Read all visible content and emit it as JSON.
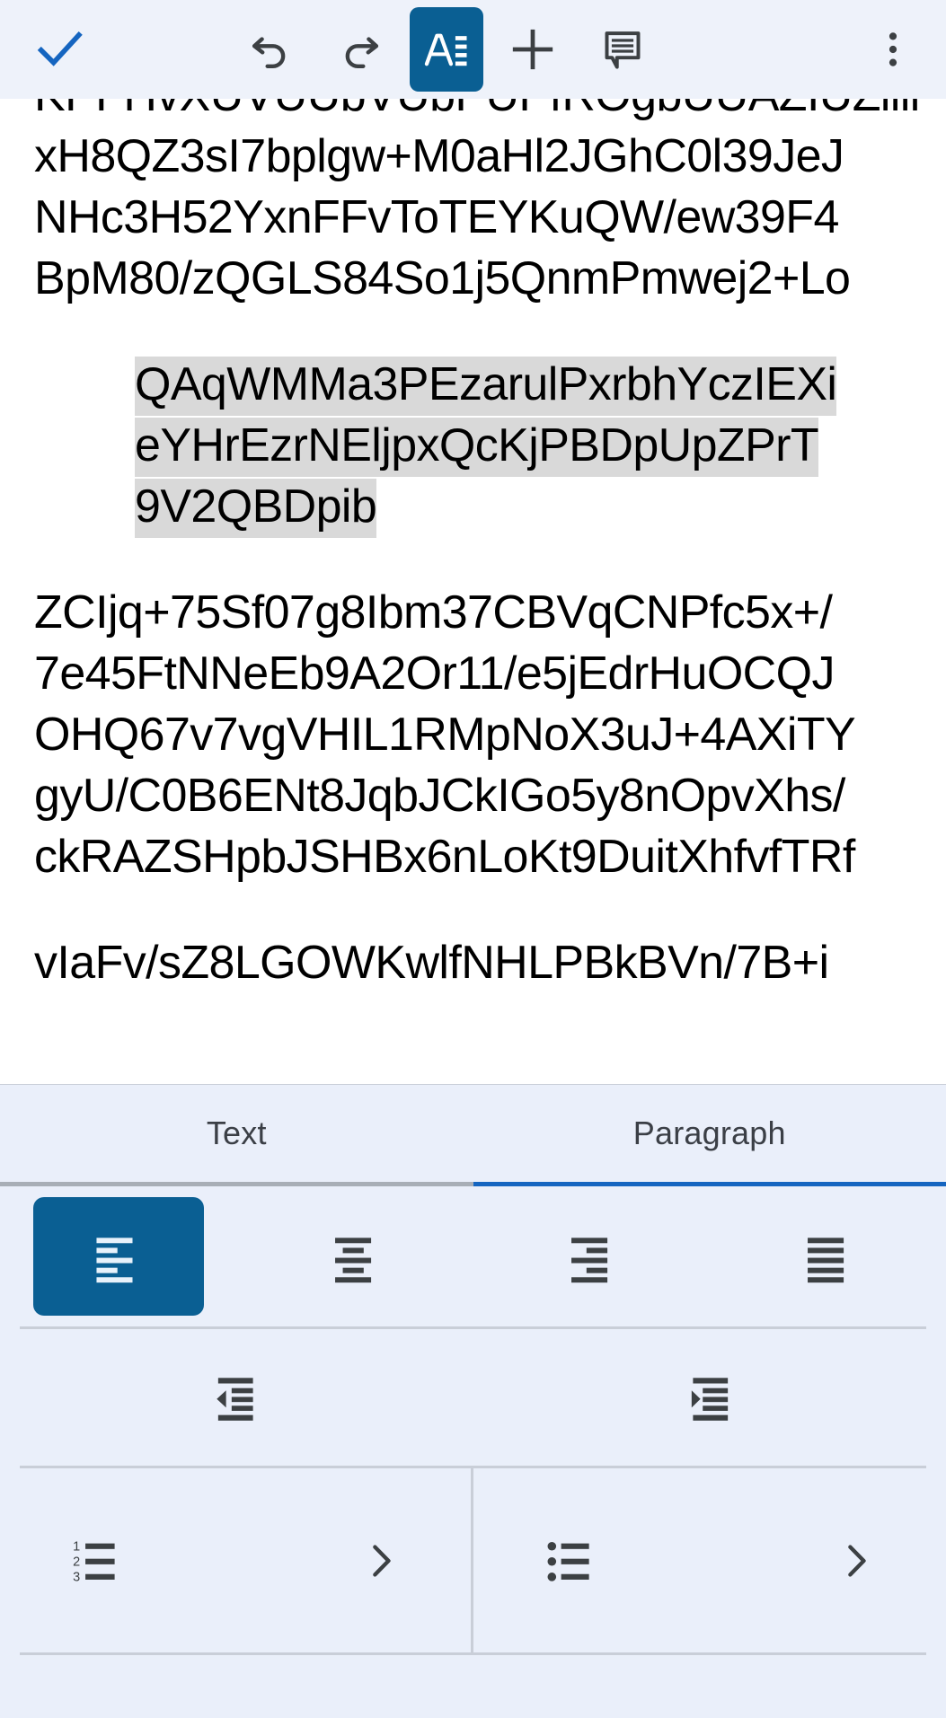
{
  "app": {
    "name": "mobile-document-editor",
    "accent_color": "#0a5f93",
    "tab_active_color": "#1565c0",
    "panel_background": "#eaeffa",
    "toolbar_background": "#eef2fa",
    "selection_highlight_color": "#d9d9d9"
  },
  "toolbar": {
    "done_label": "done-check",
    "undo_label": "undo",
    "redo_label": "redo",
    "format_label": "format-text",
    "insert_label": "insert",
    "comment_label": "comment",
    "overflow_label": "more-options",
    "icons": {
      "done": "check-icon",
      "undo": "undo-icon",
      "redo": "redo-icon",
      "format": "format-text-icon",
      "insert": "plus-icon",
      "comment": "comment-icon",
      "overflow": "three-dot-menu-icon"
    }
  },
  "document": {
    "paragraph_top": {
      "clipped_line": "KPFHvXUVUUbVUbPUPfROgbUUAZIUZiiii",
      "lines": [
        "xH8QZ3sI7bplgw+M0aHl2JGhC0l39JeJ",
        "NHc3H52YxnFFvToTEYKuQW/ew39F4",
        "BpM80/zQGLS84So1j5QnmPmwej2+Lo"
      ]
    },
    "paragraph_selected": {
      "is_selected": true,
      "lines": [
        "QAqWMMa3PEzarulPxrbhYczIEXi",
        "eYHrEzrNEljpxQcKjPBDpUpZPrT",
        "9V2QBDpib"
      ]
    },
    "paragraph_bottom": {
      "lines": [
        "ZCIjq+75Sf07g8Ibm37CBVqCNPfc5x+/",
        "7e45FtNNeEb9A2Or11/e5jEdrHuOCQJ",
        "OHQ67v7vgVHIL1RMpNoX3uJ+4AXiTY",
        "gyU/C0B6ENt8JqbJCkIGo5y8nOpvXhs/",
        "ckRAZSHpbJSHBx6nLoKt9DuitXhfvfTRf"
      ]
    },
    "paragraph_last": {
      "lines": [
        "vIaFv/sZ8LGOWKwlfNHLPBkBVn/7B+i"
      ]
    }
  },
  "format_panel": {
    "tabs": [
      {
        "label": "Text",
        "active": false
      },
      {
        "label": "Paragraph",
        "active": true
      }
    ],
    "alignment": {
      "group_name": "text-alignment",
      "options": [
        {
          "name": "align-left",
          "label": "Align left",
          "selected": true
        },
        {
          "name": "align-center",
          "label": "Align center",
          "selected": false
        },
        {
          "name": "align-right",
          "label": "Align right",
          "selected": false
        },
        {
          "name": "align-justify",
          "label": "Justify",
          "selected": false
        }
      ]
    },
    "indent": {
      "options": [
        {
          "name": "decrease-indent",
          "label": "Decrease indent"
        },
        {
          "name": "increase-indent",
          "label": "Increase indent"
        }
      ]
    },
    "lists": [
      {
        "name": "numbered-list",
        "label": "Numbered list",
        "chevron": "chevron-right-icon"
      },
      {
        "name": "bulleted-list",
        "label": "Bulleted list",
        "chevron": "chevron-right-icon"
      }
    ]
  }
}
